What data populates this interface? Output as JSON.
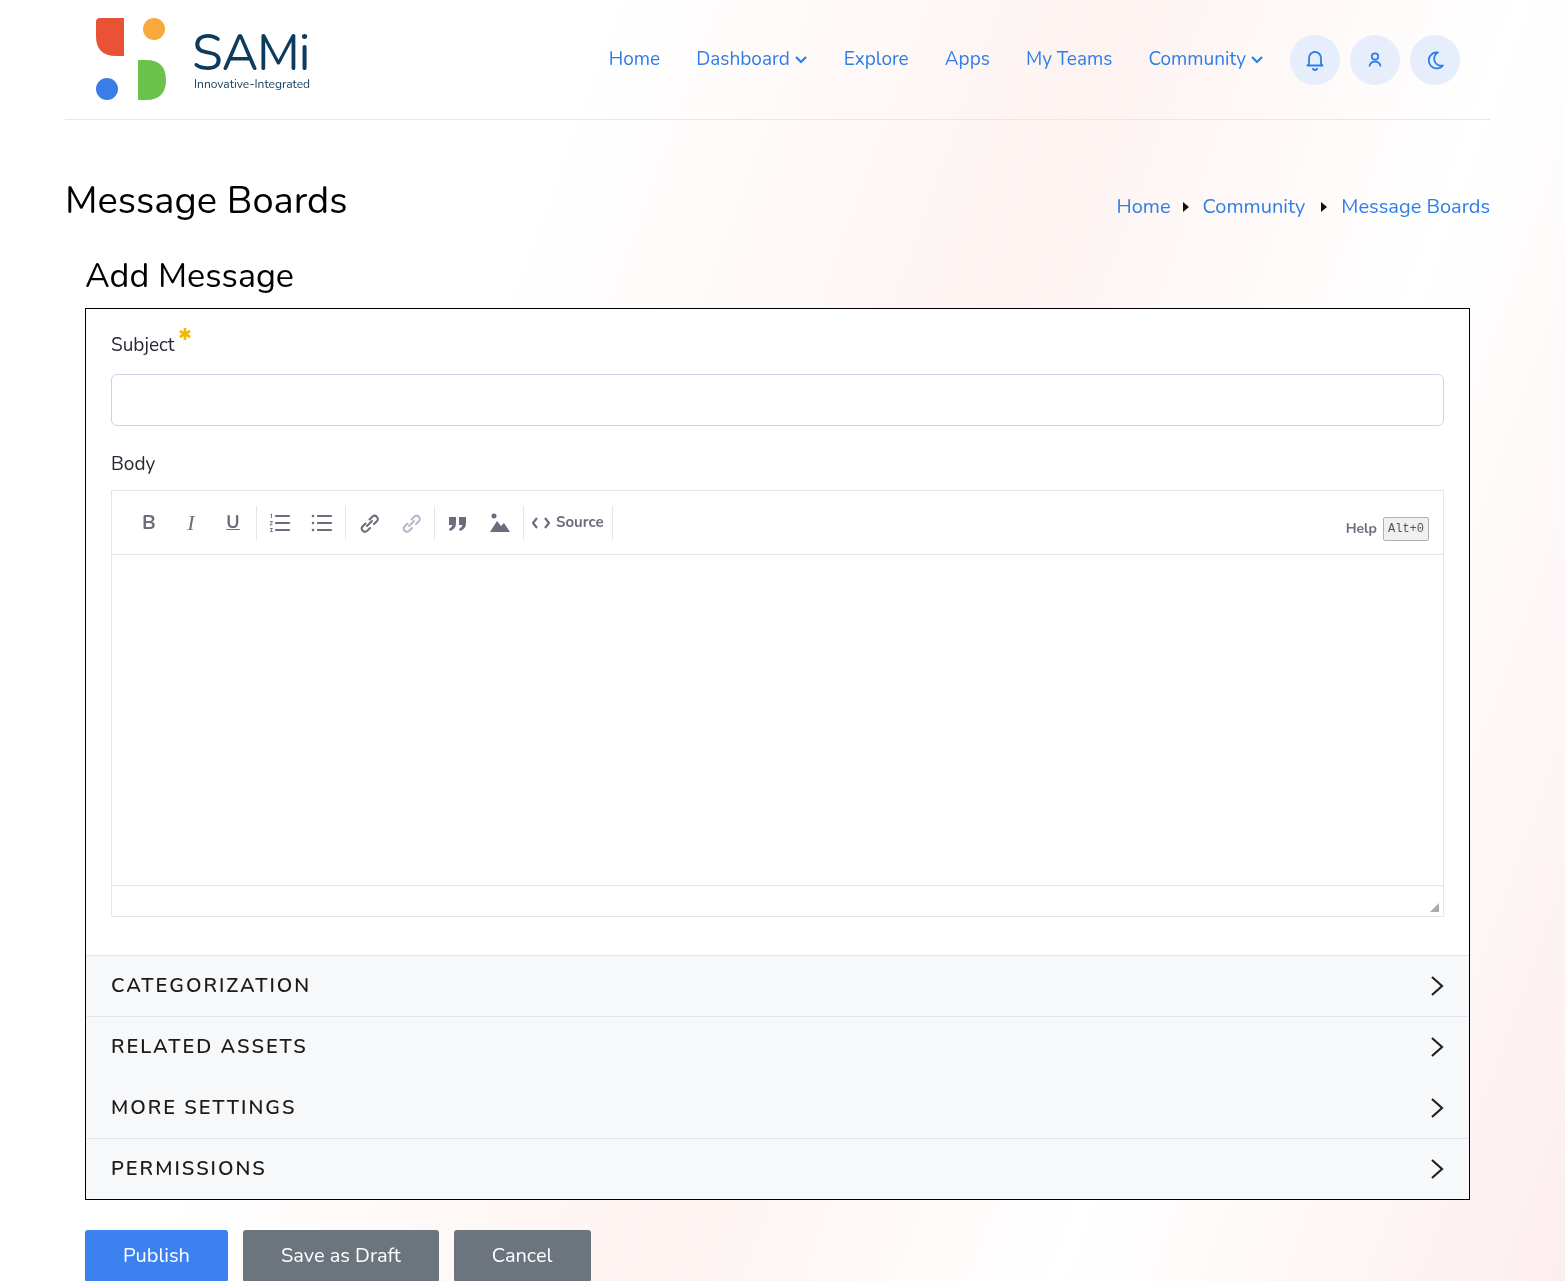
{
  "logo": {
    "name": "SAMi",
    "tagline": "Innovative-Integrated"
  },
  "nav": [
    {
      "label": "Home",
      "dropdown": false
    },
    {
      "label": "Dashboard",
      "dropdown": true
    },
    {
      "label": "Explore",
      "dropdown": false
    },
    {
      "label": "Apps",
      "dropdown": false
    },
    {
      "label": "My Teams",
      "dropdown": false
    },
    {
      "label": "Community",
      "dropdown": true
    }
  ],
  "header_buttons": [
    {
      "kind": "notifications"
    },
    {
      "kind": "user"
    },
    {
      "kind": "theme"
    }
  ],
  "page_title": "Message Boards",
  "breadcrumb": [
    "Home",
    "Community",
    "Message Boards"
  ],
  "form_title": "Add Message",
  "subject": {
    "label": "Subject",
    "required": true
  },
  "body": {
    "label": "Body",
    "help": "Help",
    "shortcut": "Alt+0"
  },
  "toolbar": [
    [
      {
        "kind": "bold",
        "text": "B",
        "disabled": false
      },
      {
        "kind": "italic",
        "text": "I",
        "disabled": false
      },
      {
        "kind": "underline",
        "text": "U",
        "disabled": false
      }
    ],
    [
      {
        "kind": "numbered-list",
        "disabled": false
      },
      {
        "kind": "bulleted-list",
        "disabled": false
      }
    ],
    [
      {
        "kind": "link",
        "disabled": false
      },
      {
        "kind": "unlink",
        "disabled": true
      }
    ],
    [
      {
        "kind": "quote",
        "disabled": false
      },
      {
        "kind": "image",
        "disabled": false
      }
    ],
    [
      {
        "kind": "source",
        "text": "Source",
        "disabled": false
      }
    ]
  ],
  "sections": [
    {
      "title": "CATEGORIZATION",
      "expanded": false
    },
    {
      "title": "RELATED ASSETS",
      "expanded": false
    },
    {
      "title": "MORE SETTINGS",
      "expanded": false
    },
    {
      "title": "PERMISSIONS",
      "expanded": false
    }
  ],
  "actions": [
    {
      "label": "Publish",
      "kind": "primary"
    },
    {
      "label": "Save as Draft",
      "kind": "secondary"
    },
    {
      "label": "Cancel",
      "kind": "secondary"
    }
  ]
}
